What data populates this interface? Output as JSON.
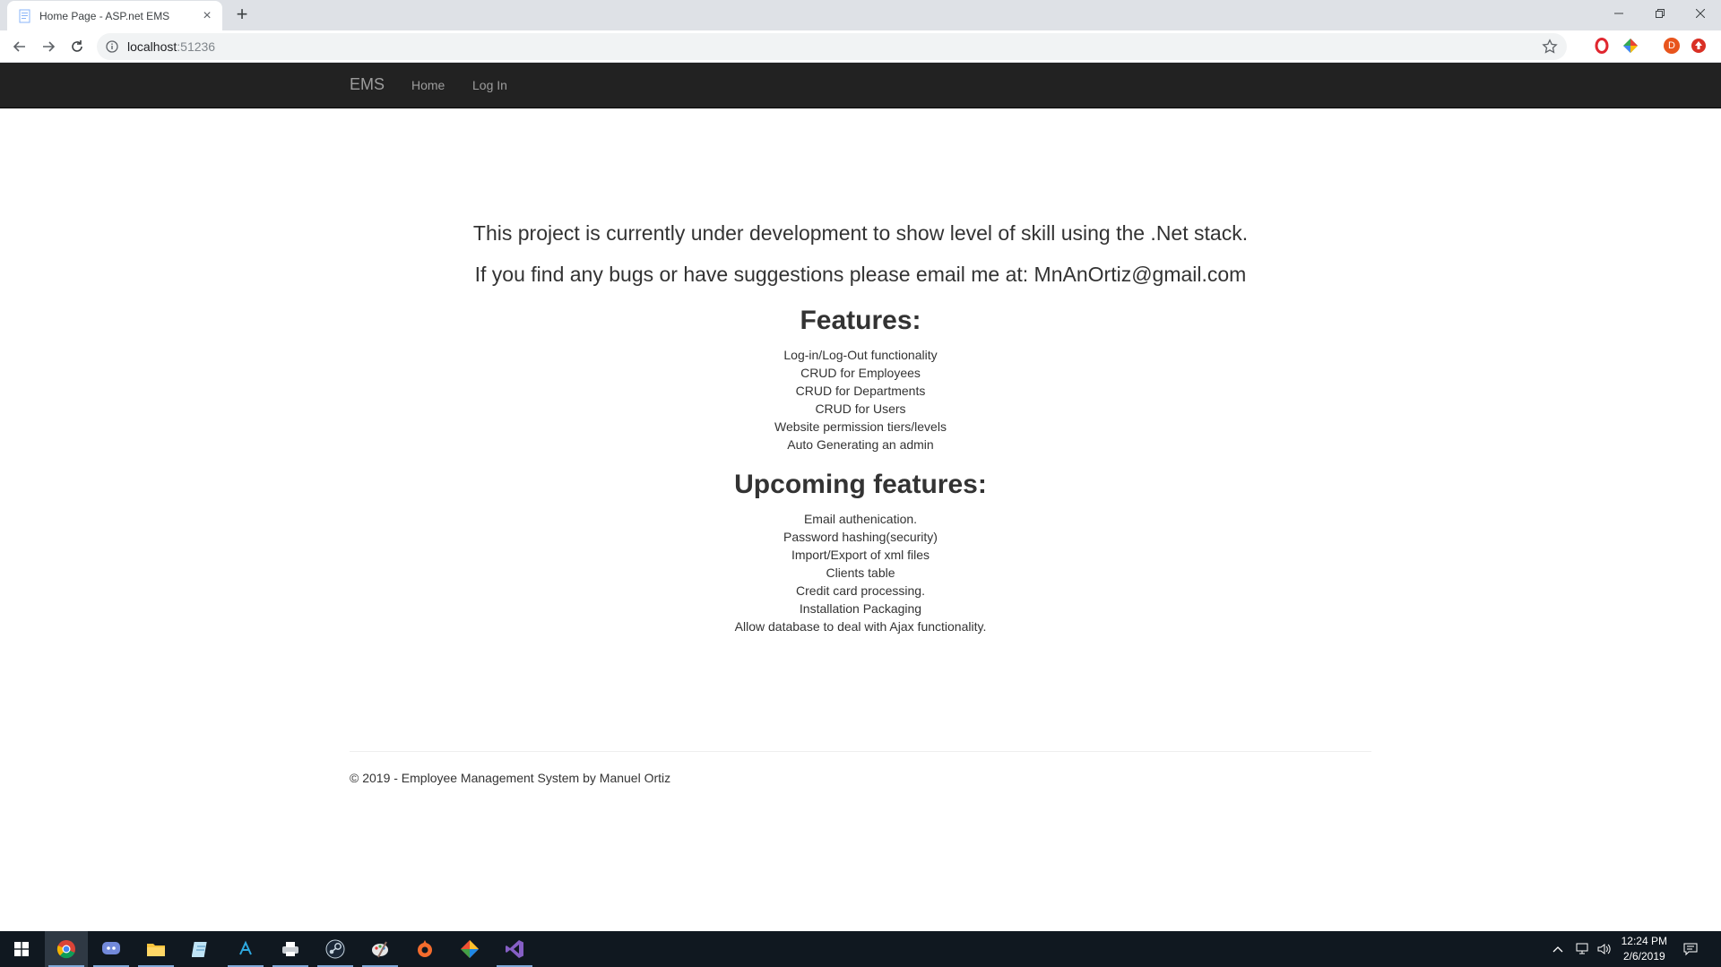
{
  "browser": {
    "tab_title": "Home Page - ASP.net EMS",
    "url_host": "localhost",
    "url_port": ":51236",
    "profile_initial": "D"
  },
  "navbar": {
    "brand": "EMS",
    "links": [
      "Home",
      "Log In"
    ]
  },
  "main": {
    "intro_line1": "This project is currently under development to show level of skill using the .Net stack.",
    "intro_line2": "If you find any bugs or have suggestions please email me at: MnAnOrtiz@gmail.com",
    "features_heading": "Features:",
    "features": [
      "Log-in/Log-Out functionality",
      "CRUD for Employees",
      "CRUD for Departments",
      "CRUD for Users",
      "Website permission tiers/levels",
      "Auto Generating an admin"
    ],
    "upcoming_heading": "Upcoming features:",
    "upcoming": [
      "Email authenication.",
      "Password hashing(security)",
      "Import/Export of xml files",
      "Clients table",
      "Credit card processing.",
      "Installation Packaging",
      "Allow database to deal with Ajax functionality."
    ]
  },
  "footer": {
    "text": "© 2019 - Employee Management System by Manuel Ortiz"
  },
  "taskbar": {
    "apps": [
      "chrome-icon",
      "discord-icon",
      "file-explorer-icon",
      "notepad-icon",
      "azure-data-studio-icon",
      "printer-icon",
      "steam-icon",
      "paint-icon",
      "origin-icon",
      "git-icon",
      "visual-studio-icon"
    ],
    "time": "12:24 PM",
    "date": "2/6/2019"
  },
  "colors": {
    "navbar_bg": "#222222",
    "navbar_text": "#9d9d9d",
    "text": "#333333",
    "taskbar_bg": "#101820"
  }
}
